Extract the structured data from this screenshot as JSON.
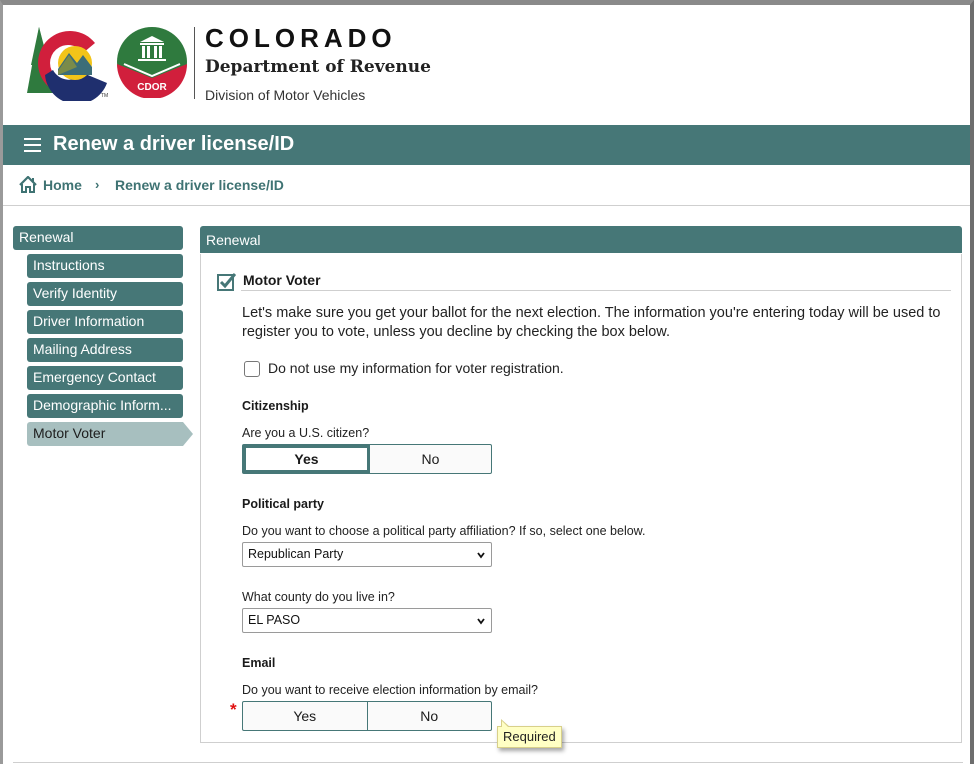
{
  "header": {
    "state": "COLORADO",
    "department": "Department of Revenue",
    "division": "Division of Motor Vehicles",
    "logo_co_label": "Colorado state logo",
    "logo_cdor_text": "CDOR"
  },
  "titlebar": {
    "menu_icon": "hamburger-menu-icon",
    "title": "Renew a driver license/ID"
  },
  "breadcrumb": {
    "home_icon": "home-icon",
    "home": "Home",
    "separator": "›",
    "current": "Renew a driver license/ID"
  },
  "sidebar": {
    "heading": "Renewal",
    "items": [
      {
        "label": "Instructions",
        "active": false
      },
      {
        "label": "Verify Identity",
        "active": false
      },
      {
        "label": "Driver Information",
        "active": false
      },
      {
        "label": "Mailing Address",
        "active": false
      },
      {
        "label": "Emergency Contact",
        "active": false
      },
      {
        "label": "Demographic Inform...",
        "active": false
      },
      {
        "label": "Motor Voter",
        "active": true
      }
    ]
  },
  "panel": {
    "heading": "Renewal",
    "section": {
      "title": "Motor Voter",
      "checked": true,
      "intro": "Let's make sure you get your ballot for the next election. The information you're entering today will be used to register you to vote, unless you decline by checking the box below.",
      "optout_label": "Do not use my information for voter registration.",
      "optout_checked": false
    },
    "citizenship": {
      "heading": "Citizenship",
      "question": "Are you a U.S. citizen?",
      "options": [
        "Yes",
        "No"
      ],
      "selected": "Yes"
    },
    "party": {
      "heading": "Political party",
      "question": "Do you want to choose a political party affiliation? If so, select one below.",
      "selected": "Republican Party"
    },
    "county": {
      "question": "What county do you live in?",
      "selected": "EL PASO"
    },
    "email": {
      "heading": "Email",
      "question": "Do you want to receive election information by email?",
      "options": [
        "Yes",
        "No"
      ],
      "selected": null,
      "required_marker": "*",
      "tooltip": "Required"
    }
  },
  "colors": {
    "brand_teal": "#467777",
    "active_nav": "#a7bfbf",
    "required": "#e01010",
    "tooltip_bg": "#ffffc4"
  }
}
